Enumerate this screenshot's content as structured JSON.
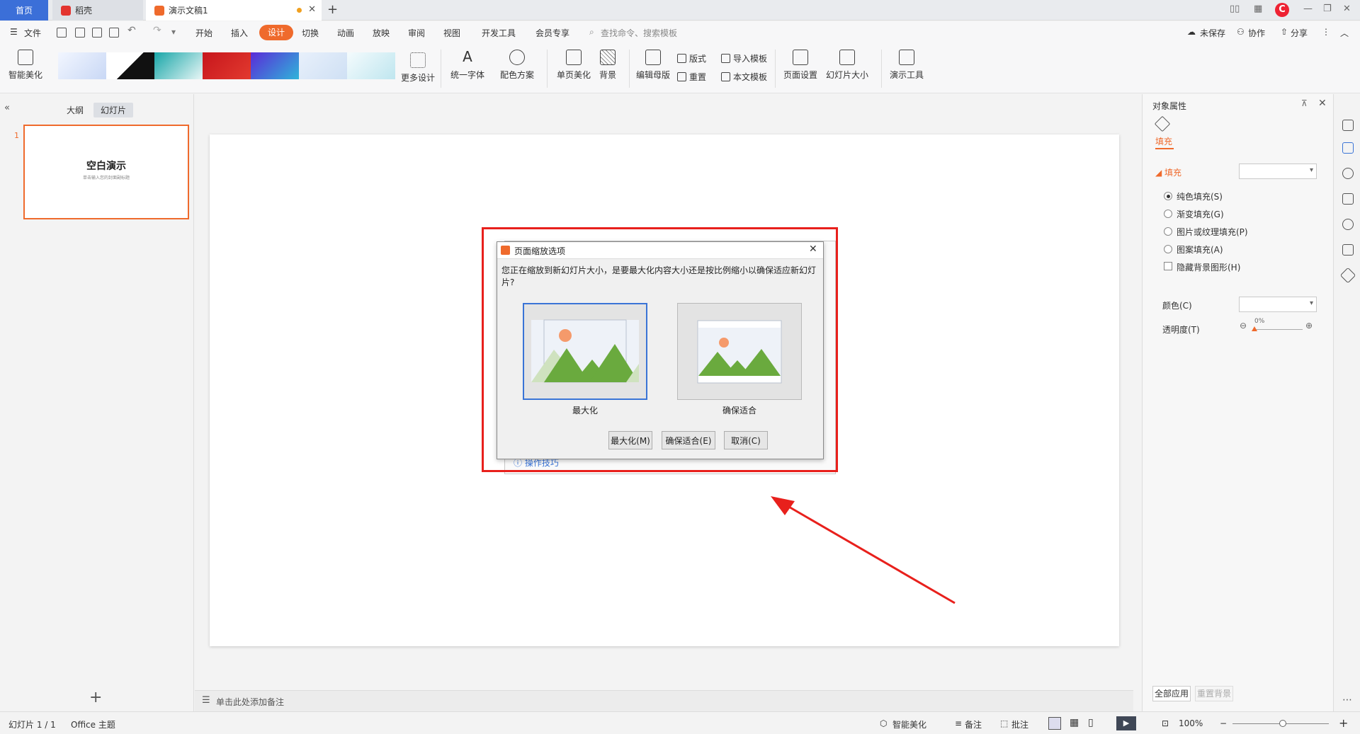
{
  "tabs": {
    "home": "首页",
    "daoke": "稻壳",
    "doc": "演示文稿1"
  },
  "menu": {
    "file": "文件",
    "items": [
      "开始",
      "插入",
      "设计",
      "切换",
      "动画",
      "放映",
      "审阅",
      "视图",
      "开发工具",
      "会员专享"
    ],
    "active": "设计",
    "search_placeholder": "查找命令、搜索模板",
    "unsaved": "未保存",
    "collab": "协作",
    "share": "分享"
  },
  "ribbon": {
    "smart_beautify": "智能美化",
    "more_design": "更多设计",
    "unify_font": "统一字体",
    "color_scheme": "配色方案",
    "page_beautify": "单页美化",
    "background": "背景",
    "edit_master": "编辑母版",
    "layout": "版式",
    "reset": "重置",
    "import_template": "导入模板",
    "text_template": "本文模板",
    "page_setup": "页面设置",
    "slide_size": "幻灯片大小",
    "presentation_tools": "演示工具"
  },
  "left_panel": {
    "outline": "大纲",
    "slides": "幻灯片",
    "slide_number": "1",
    "thumb_title": "空白演示",
    "thumb_subtitle": "单击输入您的封面副标题"
  },
  "notes": {
    "placeholder": "单击此处添加备注"
  },
  "dialog": {
    "title": "页面缩放选项",
    "message": "您正在缩放到新幻灯片大小，是要最大化内容大小还是按比例缩小以确保适应新幻灯片?",
    "option_maximize": "最大化",
    "option_fit": "确保适合",
    "btn_maximize": "最大化(M)",
    "btn_fit": "确保适合(E)",
    "btn_cancel": "取消(C)",
    "behind_hint": "操作技巧"
  },
  "right_panel": {
    "title": "对象属性",
    "tab_fill": "填充",
    "section_fill": "填充",
    "options": [
      "纯色填充(S)",
      "渐变填充(G)",
      "图片或纹理填充(P)",
      "图案填充(A)"
    ],
    "selected_option": 0,
    "hide_bg": "隐藏背景图形(H)",
    "color_label": "颜色(C)",
    "transparency_label": "透明度(T)",
    "transparency_value": "0%",
    "apply_all": "全部应用",
    "reset_bg": "重置背景"
  },
  "status": {
    "slide_count": "幻灯片 1 / 1",
    "theme": "Office 主题",
    "smart_beautify": "智能美化",
    "notes": "备注",
    "annotate": "批注",
    "zoom": "100%"
  },
  "colors": {
    "accent": "#ef6a2c",
    "highlight": "#e8201c",
    "selection": "#3a74d6",
    "mountain": "#6aaa3e",
    "sun": "#f59a6b"
  }
}
